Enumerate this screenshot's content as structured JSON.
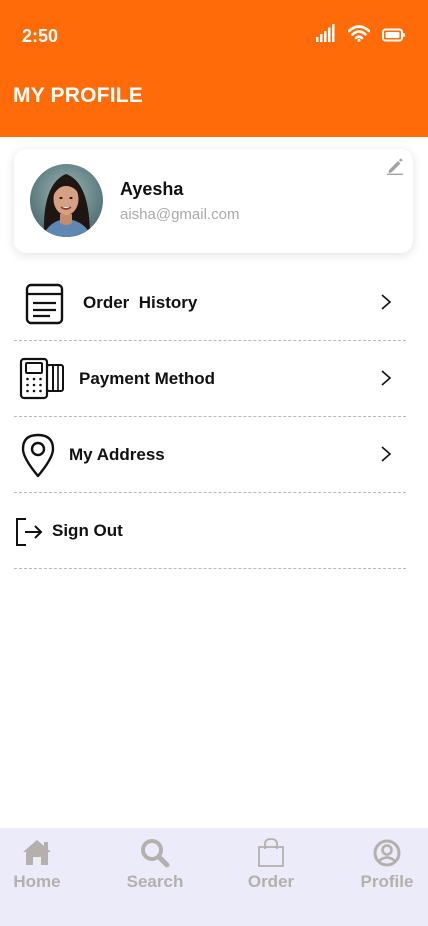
{
  "status_bar": {
    "time": "2:50"
  },
  "header": {
    "title": "MY PROFILE"
  },
  "profile": {
    "name": "Ayesha",
    "email": "aisha@gmail.com"
  },
  "menu": [
    {
      "label": "Order  History",
      "icon": "order-history-icon"
    },
    {
      "label": "Payment Method",
      "icon": "payment-terminal-icon"
    },
    {
      "label": "My Address",
      "icon": "location-pin-icon"
    },
    {
      "label": "Sign Out",
      "icon": "sign-out-icon"
    }
  ],
  "bottom_nav": [
    {
      "label": "Home",
      "icon": "home-icon"
    },
    {
      "label": "Search",
      "icon": "search-icon"
    },
    {
      "label": "Order",
      "icon": "shopping-bag-icon"
    },
    {
      "label": "Profile",
      "icon": "profile-icon"
    }
  ],
  "colors": {
    "accent": "#ff6b08",
    "nav_bg": "#ecebfa",
    "nav_text": "#b5b0ab"
  }
}
